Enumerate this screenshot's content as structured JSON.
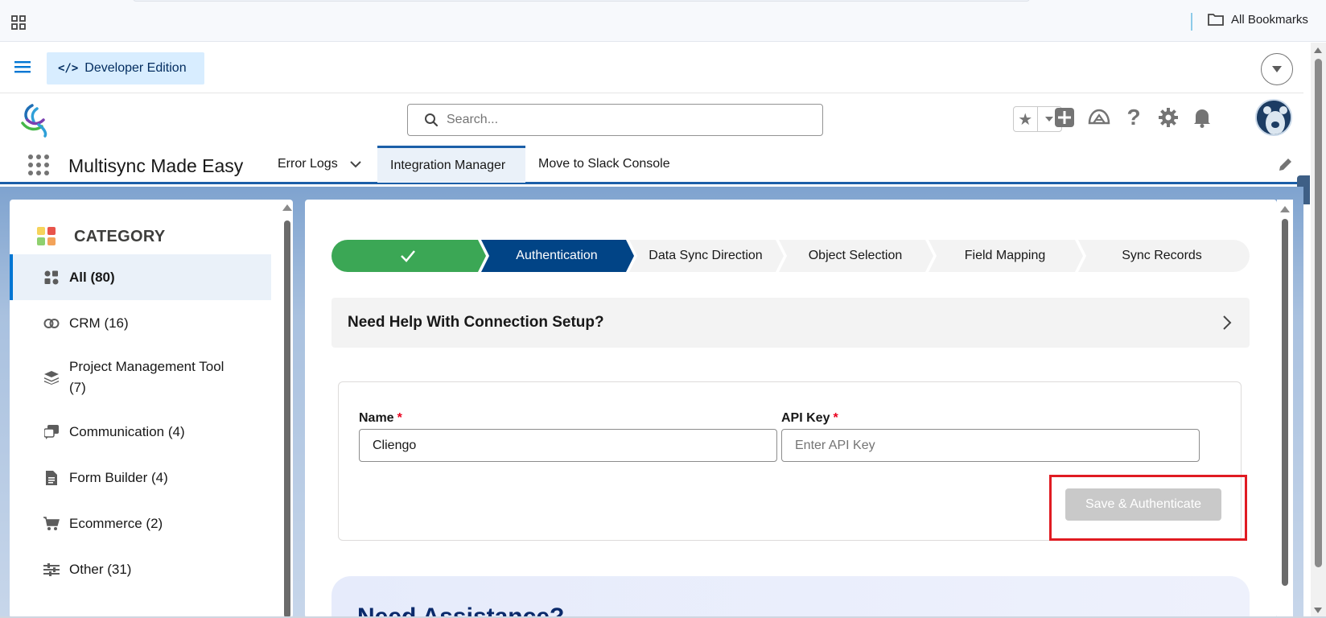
{
  "browser": {
    "bookmarks_label": "All Bookmarks"
  },
  "org_bar": {
    "edition_label": "Developer Edition"
  },
  "header": {
    "search_placeholder": "Search..."
  },
  "app_nav": {
    "app_name": "Multisync Made Easy",
    "tabs": [
      {
        "label": "Error Logs",
        "has_dropdown": true,
        "active": false
      },
      {
        "label": "Integration Manager",
        "active": true
      },
      {
        "label": "Move to Slack Console",
        "active": false
      }
    ]
  },
  "sidebar": {
    "title": "CATEGORY",
    "items": [
      {
        "label": "All (80)",
        "icon": "all-apps-icon",
        "active": true
      },
      {
        "label": "CRM (16)",
        "icon": "crm-icon"
      },
      {
        "label": "Project Management Tool",
        "label_line2": "(7)",
        "icon": "layers-icon"
      },
      {
        "label": "Communication (4)",
        "icon": "chat-icon"
      },
      {
        "label": "Form Builder (4)",
        "icon": "document-icon"
      },
      {
        "label": "Ecommerce (2)",
        "icon": "cart-icon"
      },
      {
        "label": "Other (31)",
        "icon": "sliders-icon"
      }
    ]
  },
  "path": {
    "steps": [
      {
        "label": "",
        "state": "complete",
        "icon": "check-icon"
      },
      {
        "label": "Authentication",
        "state": "current"
      },
      {
        "label": "Data Sync Direction",
        "state": "incomplete"
      },
      {
        "label": "Object Selection",
        "state": "incomplete"
      },
      {
        "label": "Field Mapping",
        "state": "incomplete"
      },
      {
        "label": "Sync Records",
        "state": "incomplete"
      }
    ]
  },
  "help": {
    "title": "Need Help With Connection Setup?"
  },
  "auth_form": {
    "name_label": "Name",
    "name_value": "Cliengo",
    "api_key_label": "API Key",
    "api_key_placeholder": "Enter API Key",
    "required_marker": "*",
    "save_button": "Save & Authenticate"
  },
  "assistance": {
    "title": "Need Assistance?"
  },
  "colors": {
    "complete": "#3ba755",
    "current": "#014486",
    "incomplete": "#f3f3f3",
    "brand": "#0176d3",
    "highlight": "#e01b22"
  }
}
